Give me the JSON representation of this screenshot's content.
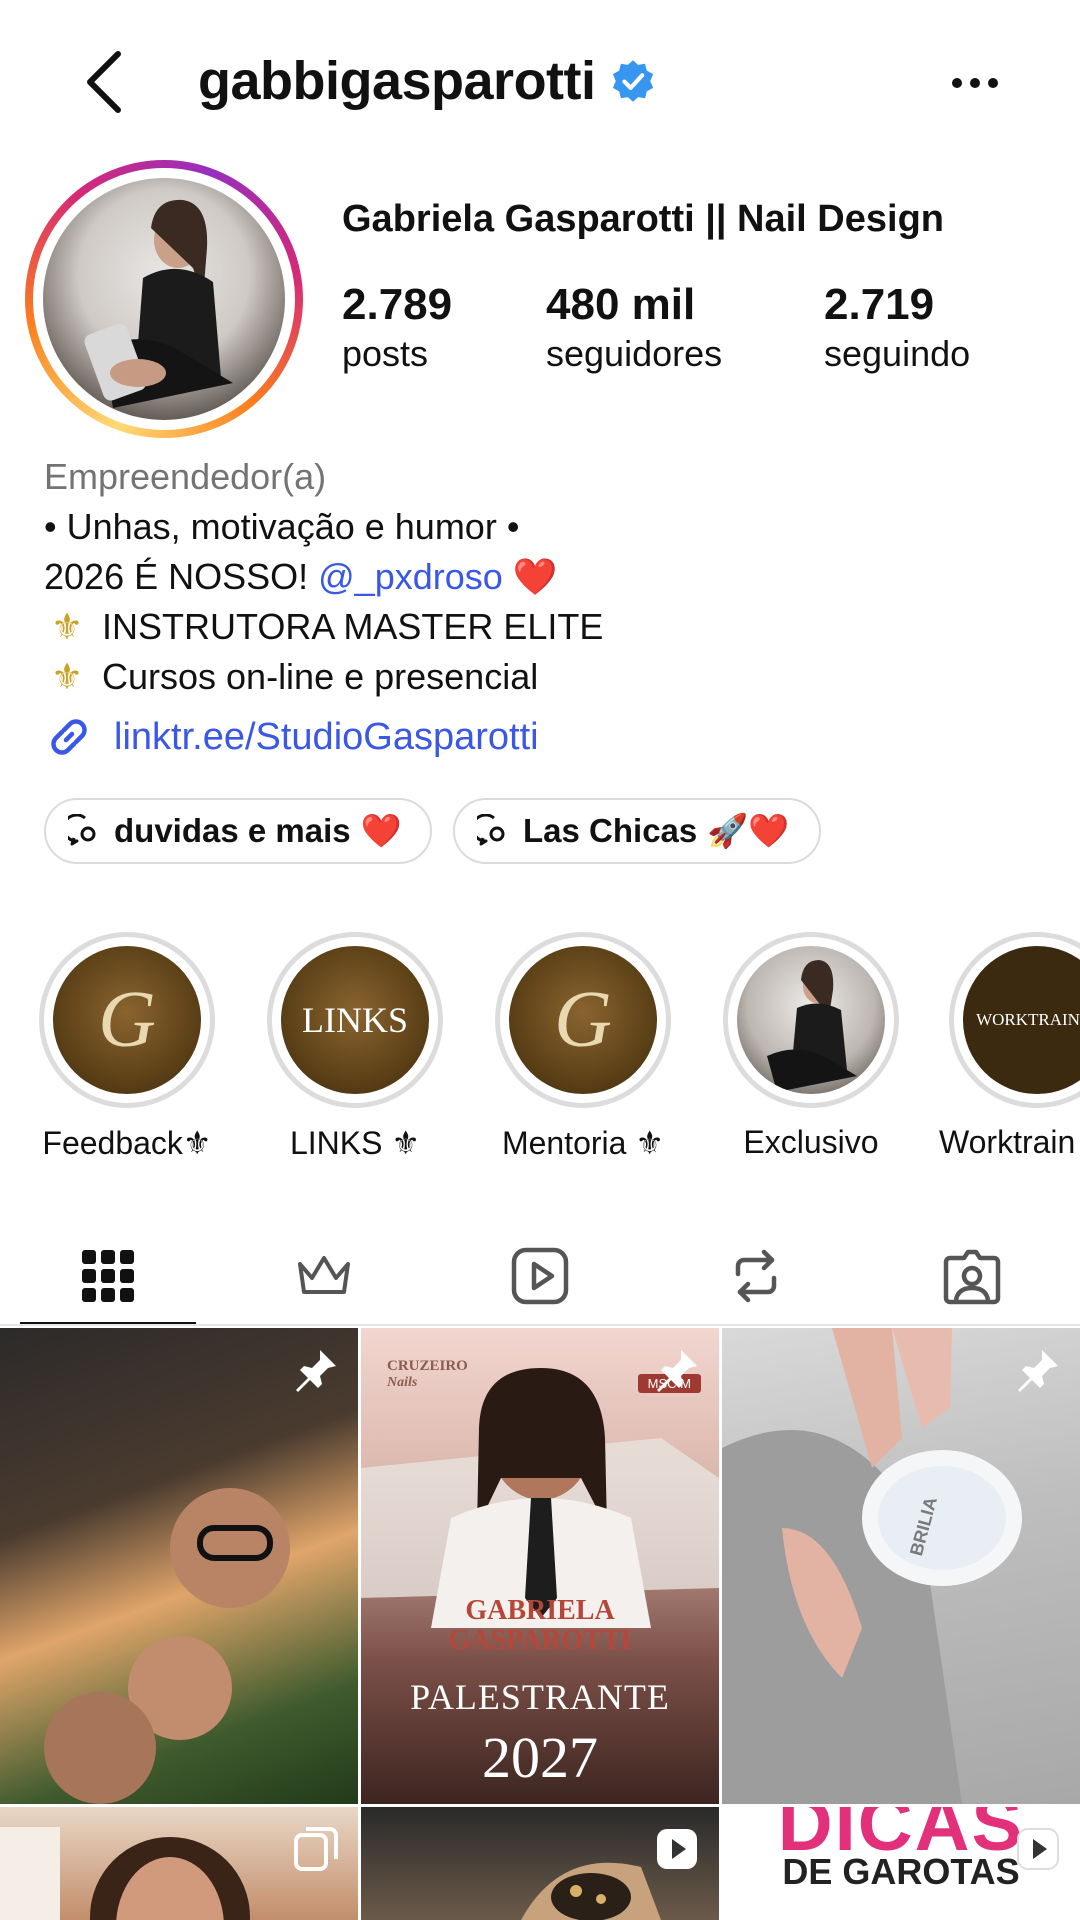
{
  "header": {
    "username": "gabbigasparotti"
  },
  "profile": {
    "full_name": "Gabriela Gasparotti || Nail Design",
    "stats": [
      {
        "value": "2.789",
        "label": "posts"
      },
      {
        "value": "480 mil",
        "label": "seguidores"
      },
      {
        "value": "2.719",
        "label": "seguindo"
      }
    ]
  },
  "bio": {
    "category": "Empreendedor(a)",
    "line1": "• Unhas, motivação e humor •",
    "line2_text": " 2026 É NOSSO! ",
    "line2_mention": "@_pxdroso",
    "line2_emoji": "❤️",
    "line3_emoji": "⚜",
    "line3_text": "INSTRUTORA MASTER ELITE",
    "line4_emoji": "⚜",
    "line4_text": "Cursos on-line e presencial",
    "link": "linktr.ee/StudioGasparotti"
  },
  "channels": [
    {
      "label": "duvidas e mais",
      "emoji": "❤️"
    },
    {
      "label": "Las Chicas",
      "emoji": "🚀❤️"
    }
  ],
  "highlights": [
    {
      "label": "Feedback⚜",
      "cover": "G"
    },
    {
      "label": "LINKS ⚜",
      "cover": "LINKS"
    },
    {
      "label": "Mentoria ⚜",
      "cover": "G"
    },
    {
      "label": "Exclusivo",
      "cover": ""
    },
    {
      "label": "Worktrain",
      "cover": "WORKTRAININ"
    }
  ],
  "posts": {
    "post2": {
      "brand": "CRUZEIRO",
      "brand_sub": "Nails",
      "date_tag": "MSC M",
      "name1": "GABRIELA",
      "name2": "GASPAROTTI",
      "role": "PALESTRANTE",
      "year": "2027"
    },
    "post3": {
      "product": "BRILIA"
    },
    "post6": {
      "title": "DICAS",
      "subtitle": "DE GAROTAS"
    }
  },
  "colors": {
    "link": "#3a57e8",
    "verified": "#3797f0",
    "heart": "#e0242f"
  }
}
